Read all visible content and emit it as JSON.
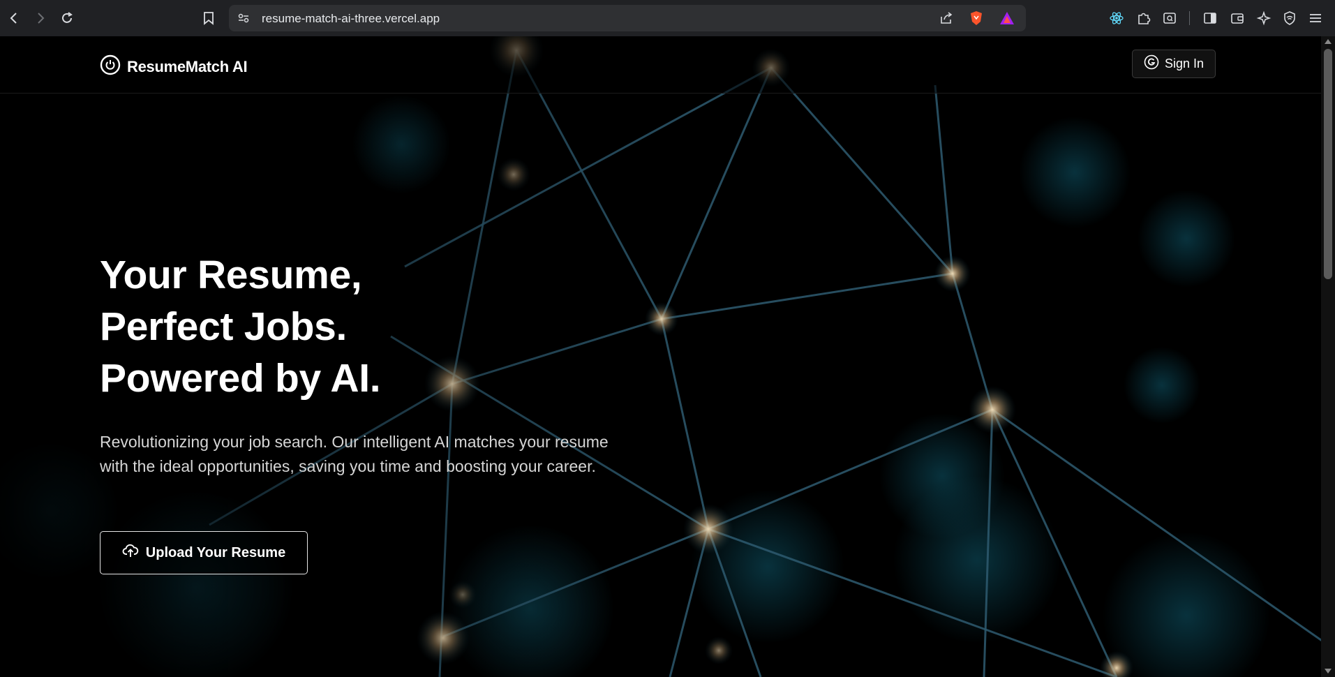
{
  "browser": {
    "url": "resume-match-ai-three.vercel.app"
  },
  "nav": {
    "brand": "ResumeMatch AI",
    "signin_label": "Sign In"
  },
  "hero": {
    "title_lines": [
      "Your Resume,",
      "Perfect Jobs.",
      "Powered by AI."
    ],
    "description": "Revolutionizing your job search. Our intelligent AI matches your resume with the ideal opportunities, saving you time and boosting your career.",
    "cta_label": "Upload Your Resume"
  },
  "colors": {
    "background": "#000000",
    "network_line": "#3f6f86",
    "network_node": "#f0d7b0",
    "text": "#ffffff"
  },
  "icons": {
    "brand": "power-icon",
    "signin": "google-g-icon",
    "cta": "cloud-upload-icon"
  }
}
